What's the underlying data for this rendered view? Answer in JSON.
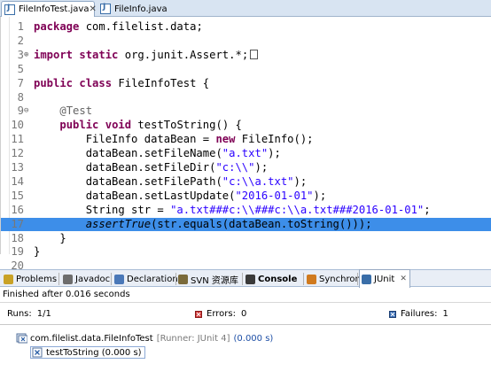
{
  "editor_tabs": [
    {
      "label": "FileInfoTest.java",
      "active": true
    },
    {
      "label": "FileInfo.java",
      "active": false
    }
  ],
  "code_lines": [
    {
      "no": "1",
      "fold": "",
      "html": "<span class=\"kw\">package</span> com.filelist.data;"
    },
    {
      "no": "2",
      "fold": "",
      "html": ""
    },
    {
      "no": "3",
      "fold": "+",
      "html": "<span class=\"kw\">import</span> <span class=\"kw\">static</span> org.junit.Assert.*;<span class=\"boxglyph\"></span>"
    },
    {
      "no": "5",
      "fold": "",
      "html": ""
    },
    {
      "no": "7",
      "fold": "",
      "html": "<span class=\"kw\">public</span> <span class=\"kw\">class</span> FileInfoTest {"
    },
    {
      "no": "8",
      "fold": "",
      "html": ""
    },
    {
      "no": "9",
      "fold": "-",
      "html": "    <span class=\"ann\">@Test</span>"
    },
    {
      "no": "10",
      "fold": "",
      "html": "    <span class=\"kw\">public</span> <span class=\"kw\">void</span> testToString() {"
    },
    {
      "no": "11",
      "fold": "",
      "html": "        FileInfo dataBean = <span class=\"kw\">new</span> FileInfo();"
    },
    {
      "no": "12",
      "fold": "",
      "html": "        dataBean.setFileName(<span class=\"str\">\"a.txt\"</span>);"
    },
    {
      "no": "13",
      "fold": "",
      "html": "        dataBean.setFileDir(<span class=\"str\">\"c:\\\\\"</span>);"
    },
    {
      "no": "14",
      "fold": "",
      "html": "        dataBean.setFilePath(<span class=\"str\">\"c:\\\\a.txt\"</span>);"
    },
    {
      "no": "15",
      "fold": "",
      "html": "        dataBean.setLastUpdate(<span class=\"str\">\"2016-01-01\"</span>);"
    },
    {
      "no": "16",
      "fold": "",
      "html": "        String str = <span class=\"str\">\"a.txt###c:\\\\###c:\\\\a.txt###2016-01-01\"</span>;"
    },
    {
      "no": "17",
      "fold": "",
      "html": "        <span class=\"ital\">assertTrue</span>(str.equals(dataBean.toString()));",
      "highlight": true
    },
    {
      "no": "18",
      "fold": "",
      "html": "    }"
    },
    {
      "no": "19",
      "fold": "",
      "html": "}"
    },
    {
      "no": "20",
      "fold": "",
      "html": ""
    }
  ],
  "view_tabs": [
    {
      "label": "Problems",
      "icon": "problems-icon",
      "color": "#c9a227"
    },
    {
      "label": "Javadoc",
      "icon": "at-icon",
      "color": "#6d6d6d"
    },
    {
      "label": "Declaration",
      "icon": "declaration-icon",
      "color": "#4a78b8"
    },
    {
      "label": "SVN 资源库",
      "icon": "svn-icon",
      "color": "#7a6a3a"
    },
    {
      "label": "Console",
      "icon": "console-icon",
      "color": "#3a3a3a",
      "bold": true
    },
    {
      "label": "Synchronize",
      "icon": "sync-icon",
      "color": "#d07a1e"
    },
    {
      "label": "JUnit",
      "icon": "junit-icon",
      "color": "#3a6ea8",
      "active": true
    }
  ],
  "junit": {
    "status": "Finished after 0.016 seconds",
    "runs_label": "Runs:",
    "runs_value": "1/1",
    "errors_label": "Errors:",
    "errors_value": "0",
    "failures_label": "Failures:",
    "failures_value": "1",
    "suite_name": "com.filelist.data.FileInfoTest",
    "suite_runner": "[Runner: JUnit 4]",
    "suite_time": "(0.000 s)",
    "test_name": "testToString (0.000 s)"
  },
  "colors": {
    "highlight": "#3d8ee9",
    "keyword": "#7f0055",
    "string": "#2a00ff"
  }
}
